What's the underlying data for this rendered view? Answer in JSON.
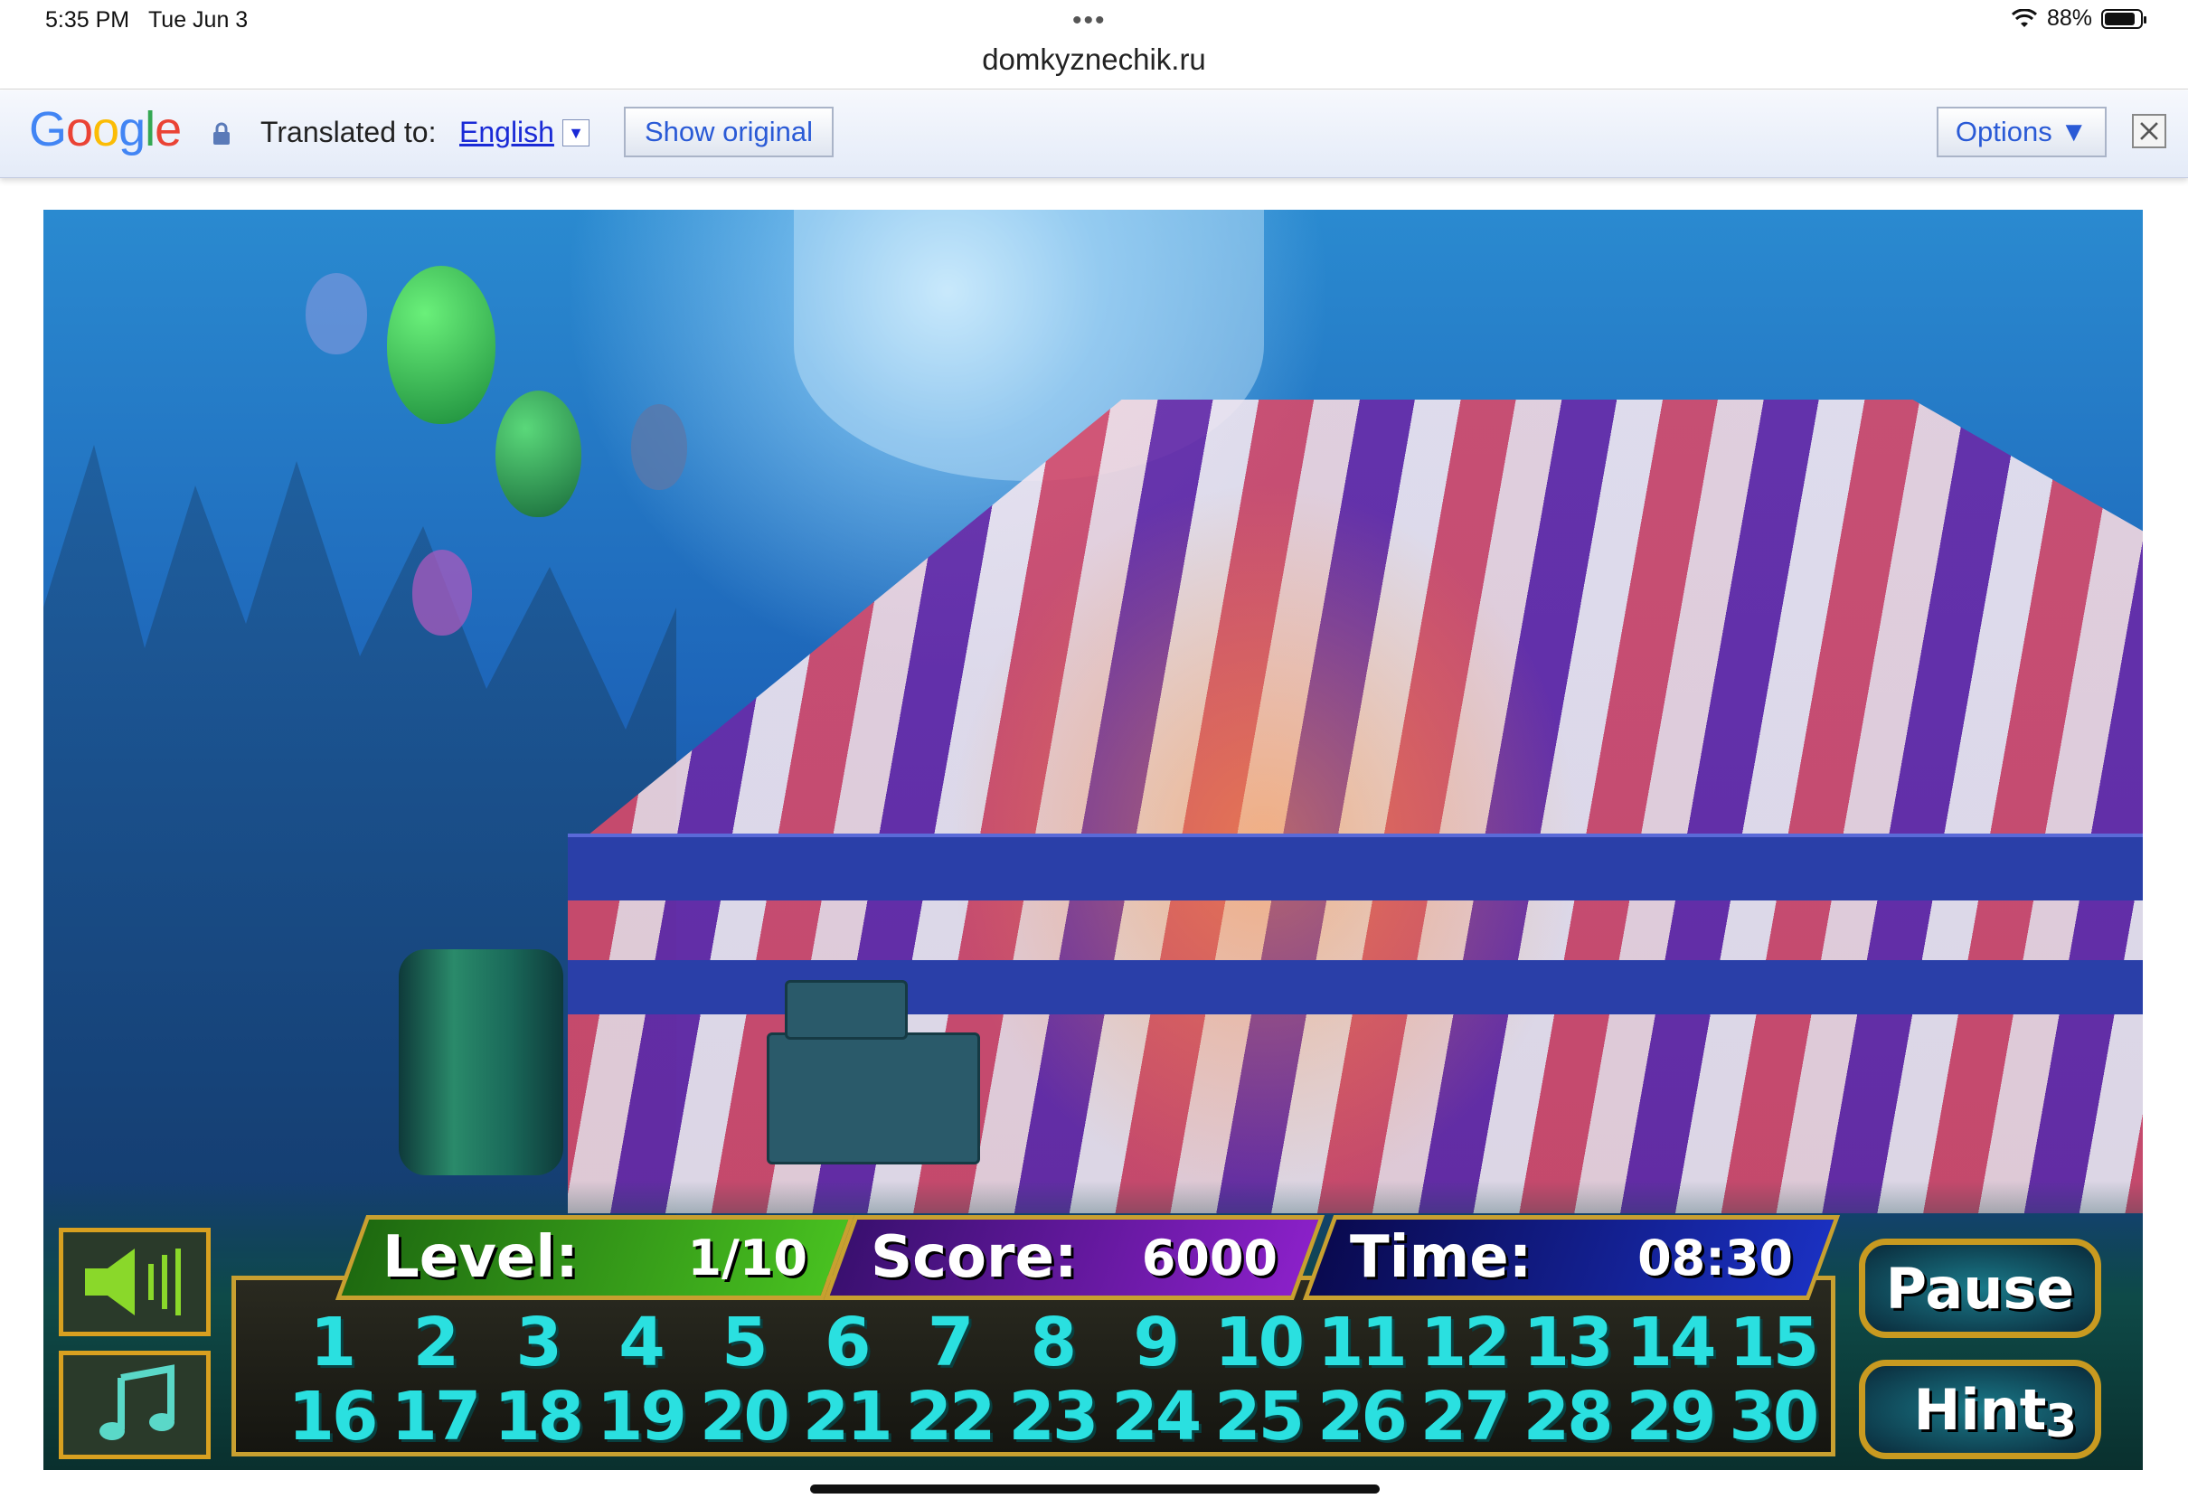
{
  "status_bar": {
    "time": "5:35 PM",
    "date": "Tue Jun 3",
    "battery": "88%",
    "battery_level": 0.88
  },
  "browser": {
    "url": "domkyznechik.ru"
  },
  "translate_bar": {
    "logo": "Google",
    "translated_to_label": "Translated to:",
    "language": "English",
    "dropdown_glyph": "▼",
    "show_original_label": "Show original",
    "options_label": "Options ▼"
  },
  "game": {
    "level_label": "Level:",
    "level_value": "1/10",
    "score_label": "Score:",
    "score_value": "6000",
    "time_label": "Time:",
    "time_value": "08:30",
    "pause_label": "Pause",
    "hint_label": "Hint",
    "hint_count": "3",
    "numbers_row1": [
      "1",
      "2",
      "3",
      "4",
      "5",
      "6",
      "7",
      "8",
      "9",
      "10",
      "11",
      "12",
      "13",
      "14",
      "15"
    ],
    "numbers_row2": [
      "16",
      "17",
      "18",
      "19",
      "20",
      "21",
      "22",
      "23",
      "24",
      "25",
      "26",
      "27",
      "28",
      "29",
      "30"
    ]
  },
  "colors": {
    "accent_gold": "#c8a030",
    "number_cyan": "#2ae0e0",
    "link_blue": "#1a2ad6"
  }
}
